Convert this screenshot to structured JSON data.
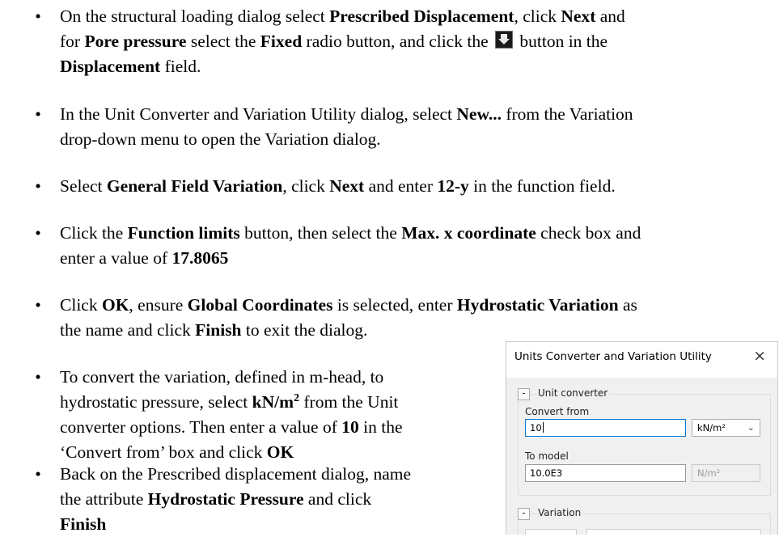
{
  "bullets": [
    {
      "lines": [
        [
          {
            "t": "On the structural loading dialog select "
          },
          {
            "t": "Prescribed Displacement",
            "b": true
          },
          {
            "t": ", click "
          },
          {
            "t": "Next",
            "b": true
          },
          {
            "t": " and"
          }
        ],
        [
          {
            "t": "for "
          },
          {
            "t": "Pore pressure",
            "b": true
          },
          {
            "t": " select the "
          },
          {
            "t": "Fixed",
            "b": true
          },
          {
            "t": " radio button, and click the "
          },
          {
            "icon": "download-arrow-icon"
          },
          {
            "t": " button in the"
          }
        ],
        [
          {
            "t": "Displacement",
            "b": true
          },
          {
            "t": " field."
          }
        ]
      ]
    },
    {
      "lines": [
        [
          {
            "t": "In the Unit Converter and Variation Utility dialog, select "
          },
          {
            "t": "New...",
            "b": true
          },
          {
            "t": " from the Variation"
          }
        ],
        [
          {
            "t": "drop-down menu to open the Variation dialog."
          }
        ]
      ]
    },
    {
      "lines": [
        [
          {
            "t": "Select "
          },
          {
            "t": "General Field Variation",
            "b": true
          },
          {
            "t": ", click "
          },
          {
            "t": "Next",
            "b": true
          },
          {
            "t": " and enter "
          },
          {
            "t": "12-y",
            "b": true
          },
          {
            "t": " in the function field."
          }
        ]
      ]
    },
    {
      "lines": [
        [
          {
            "t": "Click the "
          },
          {
            "t": "Function limits",
            "b": true
          },
          {
            "t": " button, then select the "
          },
          {
            "t": "Max. x coordinate",
            "b": true
          },
          {
            "t": " check box and"
          }
        ],
        [
          {
            "t": "enter a value of "
          },
          {
            "t": "17.8065",
            "b": true
          }
        ]
      ]
    },
    {
      "lines": [
        [
          {
            "t": "Click "
          },
          {
            "t": "OK",
            "b": true
          },
          {
            "t": ", ensure "
          },
          {
            "t": "Global Coordinates",
            "b": true
          },
          {
            "t": " is selected, enter "
          },
          {
            "t": "Hydrostatic Variation",
            "b": true
          },
          {
            "t": " as"
          }
        ],
        [
          {
            "t": "the name and click "
          },
          {
            "t": "Finish",
            "b": true
          },
          {
            "t": " to exit the dialog."
          }
        ]
      ]
    },
    {
      "lines": [
        [
          {
            "t": "To convert the variation, defined in m-head, to"
          }
        ],
        [
          {
            "t": "hydrostatic pressure, select "
          },
          {
            "t": "kN/m",
            "b": true
          },
          {
            "t": "2",
            "b": true,
            "sup": true
          },
          {
            "t": " from the Unit"
          }
        ],
        [
          {
            "t": "converter options. Then enter a value of "
          },
          {
            "t": "10",
            "b": true
          },
          {
            "t": " in the"
          }
        ],
        [
          {
            "t": "‘Convert from’ box and click "
          },
          {
            "t": "OK",
            "b": true
          }
        ]
      ]
    },
    {
      "lines": [
        [
          {
            "t": "Back on the Prescribed displacement dialog, name"
          }
        ],
        [
          {
            "t": "the attribute "
          },
          {
            "t": "Hydrostatic Pressure",
            "b": true
          },
          {
            "t": " and click"
          }
        ],
        [
          {
            "t": "Finish",
            "b": true
          }
        ]
      ]
    }
  ],
  "bullet_char": "•",
  "dialog": {
    "title": "Units Converter and Variation Utility",
    "close_glyph": "×",
    "unit_converter": {
      "group_label": "Unit converter",
      "collapse_glyph": "-",
      "convert_from_label": "Convert from",
      "convert_from_value": "10",
      "convert_from_unit": "kN/m²",
      "to_model_label": "To model",
      "to_model_value": "10.0E3",
      "to_model_unit": "N/m²"
    },
    "variation": {
      "group_label": "Variation",
      "collapse_glyph": "-"
    }
  }
}
